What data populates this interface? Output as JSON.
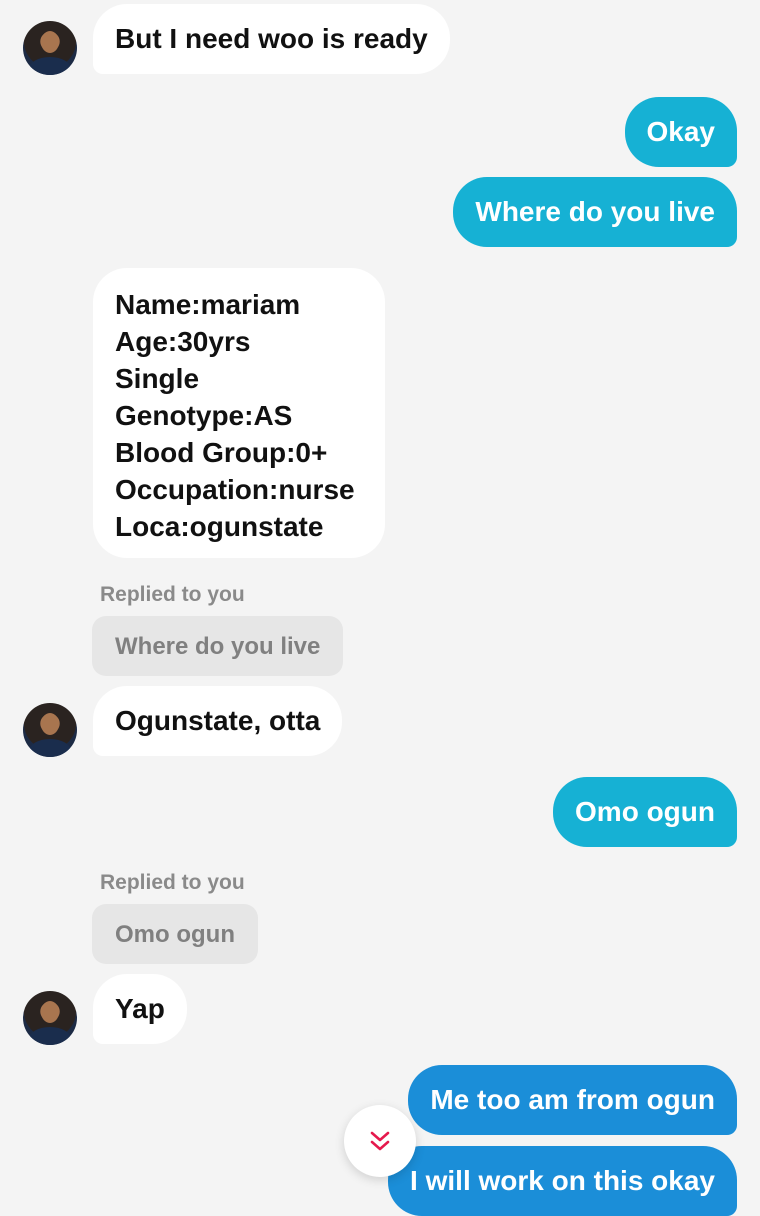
{
  "messages": [
    {
      "text": "But I need woo is ready"
    },
    {
      "text": "Okay"
    },
    {
      "text": "Where do you live"
    },
    {
      "lines": [
        "Name:mariam",
        "Age:30yrs",
        "Single",
        "Genotype:AS",
        "Blood Group:0+",
        "Occupation:nurse",
        "Loca:ogunstate"
      ]
    },
    {
      "reply_caption": "Replied to you",
      "quoted": "Where do you live",
      "text": "Ogunstate, otta"
    },
    {
      "text": "Omo ogun"
    },
    {
      "reply_caption": "Replied to you",
      "quoted": "Omo ogun",
      "text": "Yap"
    },
    {
      "text": "Me too am from ogun"
    },
    {
      "text": "I will work on this okay"
    }
  ],
  "scroll_button": {
    "icon": "double-chevron-down-icon",
    "color": "#e5194d"
  },
  "colors": {
    "background": "#f4f4f4",
    "incoming": "#ffffff",
    "outgoing_cyan": "#16b1d4",
    "outgoing_blue": "#1b8ed8"
  }
}
